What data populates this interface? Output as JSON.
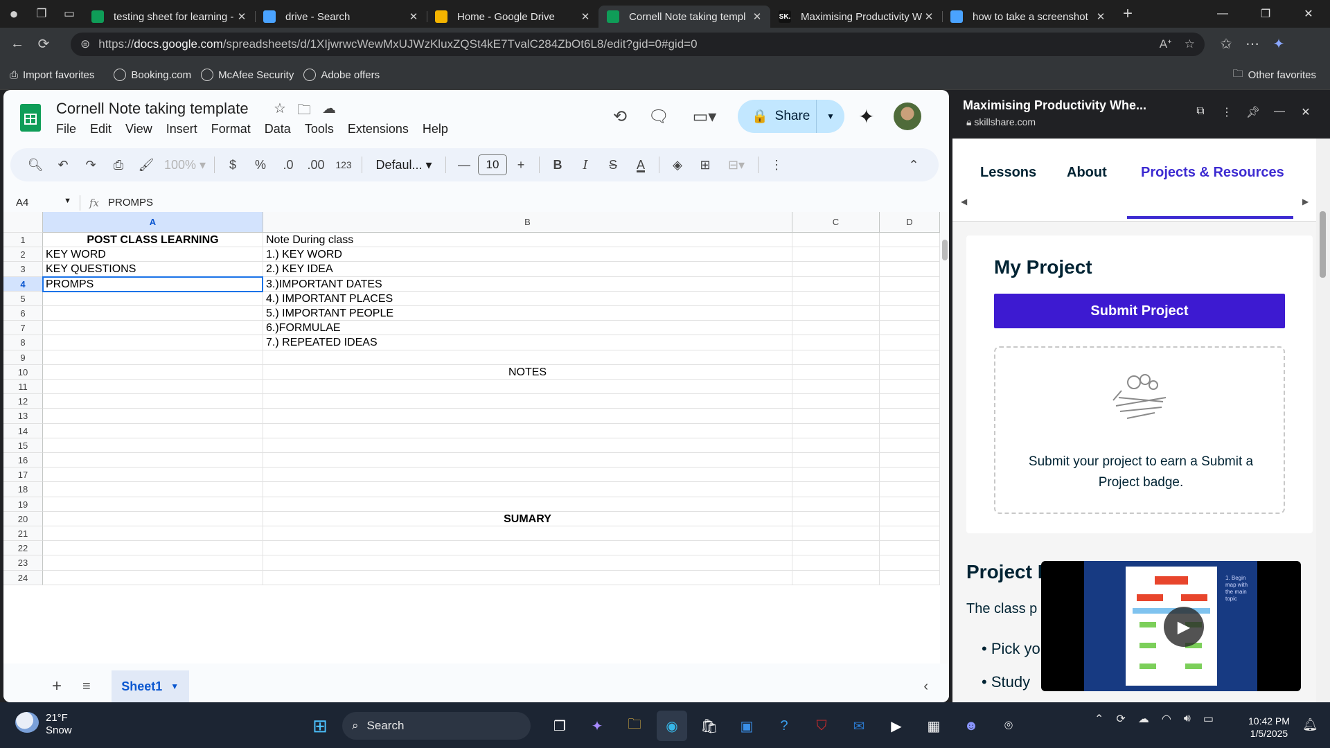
{
  "browser": {
    "tabs": [
      {
        "title": "testing sheet for learning -",
        "favicon": "sheets-icon",
        "color": "#0f9d58",
        "active": false
      },
      {
        "title": "drive - Search",
        "favicon": "search-icon",
        "color": "#4aa3ff",
        "active": false
      },
      {
        "title": "Home - Google Drive",
        "favicon": "drive-icon",
        "color": "#f4b400",
        "active": false
      },
      {
        "title": "Cornell Note taking templ",
        "favicon": "sheets-icon",
        "color": "#0f9d58",
        "active": true
      },
      {
        "title": "Maximising Productivity W",
        "favicon": "skillshare-icon",
        "fav_text": "SK.",
        "color": "#111111",
        "active": false
      },
      {
        "title": "how to take a screenshot",
        "favicon": "search-icon",
        "color": "#4aa3ff",
        "active": false
      }
    ],
    "url_prefix": "https://",
    "url_host": "docs.google.com",
    "url_path": "/spreadsheets/d/1XIjwrwcWewMxUJWzKluxZQSt4kE7TvalC284ZbOt6L8/edit?gid=0#gid=0",
    "favorites": [
      "Import favorites",
      "Booking.com",
      "McAfee Security",
      "Adobe offers"
    ],
    "other_favorites": "Other favorites"
  },
  "sheets": {
    "doc_title": "Cornell Note taking template",
    "menus": [
      "File",
      "Edit",
      "View",
      "Insert",
      "Format",
      "Data",
      "Tools",
      "Extensions",
      "Help"
    ],
    "share_label": "Share",
    "zoom": "100%",
    "currency": "$",
    "percent": "%",
    "dec_minus": ".0",
    "dec_plus": ".00",
    "number_format": "123",
    "font_name": "Defaul...",
    "font_size": "10",
    "name_box": "A4",
    "formula_value": "PROMPS",
    "columns": [
      "A",
      "B",
      "C",
      "D"
    ],
    "rows": [
      "1",
      "2",
      "3",
      "4",
      "5",
      "6",
      "7",
      "8",
      "9",
      "10",
      "11",
      "12",
      "13",
      "14",
      "15",
      "16",
      "17",
      "18",
      "19",
      "20",
      "21",
      "22",
      "23",
      "24"
    ],
    "cells": {
      "A1": "POST CLASS LEARNING",
      "B1": "Note During class",
      "A2": "KEY WORD",
      "B2": "1.) KEY WORD",
      "A3": "KEY QUESTIONS",
      "B3": "2.) KEY IDEA",
      "A4": "PROMPS",
      "B4": "3.)IMPORTANT DATES",
      "B5": "4.) IMPORTANT PLACES",
      "B6": "5.) IMPORTANT PEOPLE",
      "B7": "6.)FORMULAE",
      "B8": "7.) REPEATED IDEAS",
      "B10": "NOTES",
      "B20": "SUMARY"
    },
    "sheet_tab": "Sheet1",
    "accent": "#0b57d0"
  },
  "panel": {
    "title": "Maximising Productivity Whe...",
    "url": "skillshare.com",
    "tabs": [
      "Lessons",
      "About",
      "Projects & Resources"
    ],
    "active_tab": "Projects & Resources",
    "card_heading": "My Project",
    "submit_label": "Submit Project",
    "badge_text": "Submit your project to earn a Submit a Project badge.",
    "project_heading": "Project I",
    "project_sub": "The class p",
    "bullets": [
      "Pick yo",
      "Study"
    ],
    "video_note": "1. Begin map with the main topic",
    "accent": "#3d1ad1"
  },
  "taskbar": {
    "temp": "21°F",
    "weather": "Snow",
    "search_placeholder": "Search",
    "time": "10:42 PM",
    "date": "1/5/2025"
  }
}
